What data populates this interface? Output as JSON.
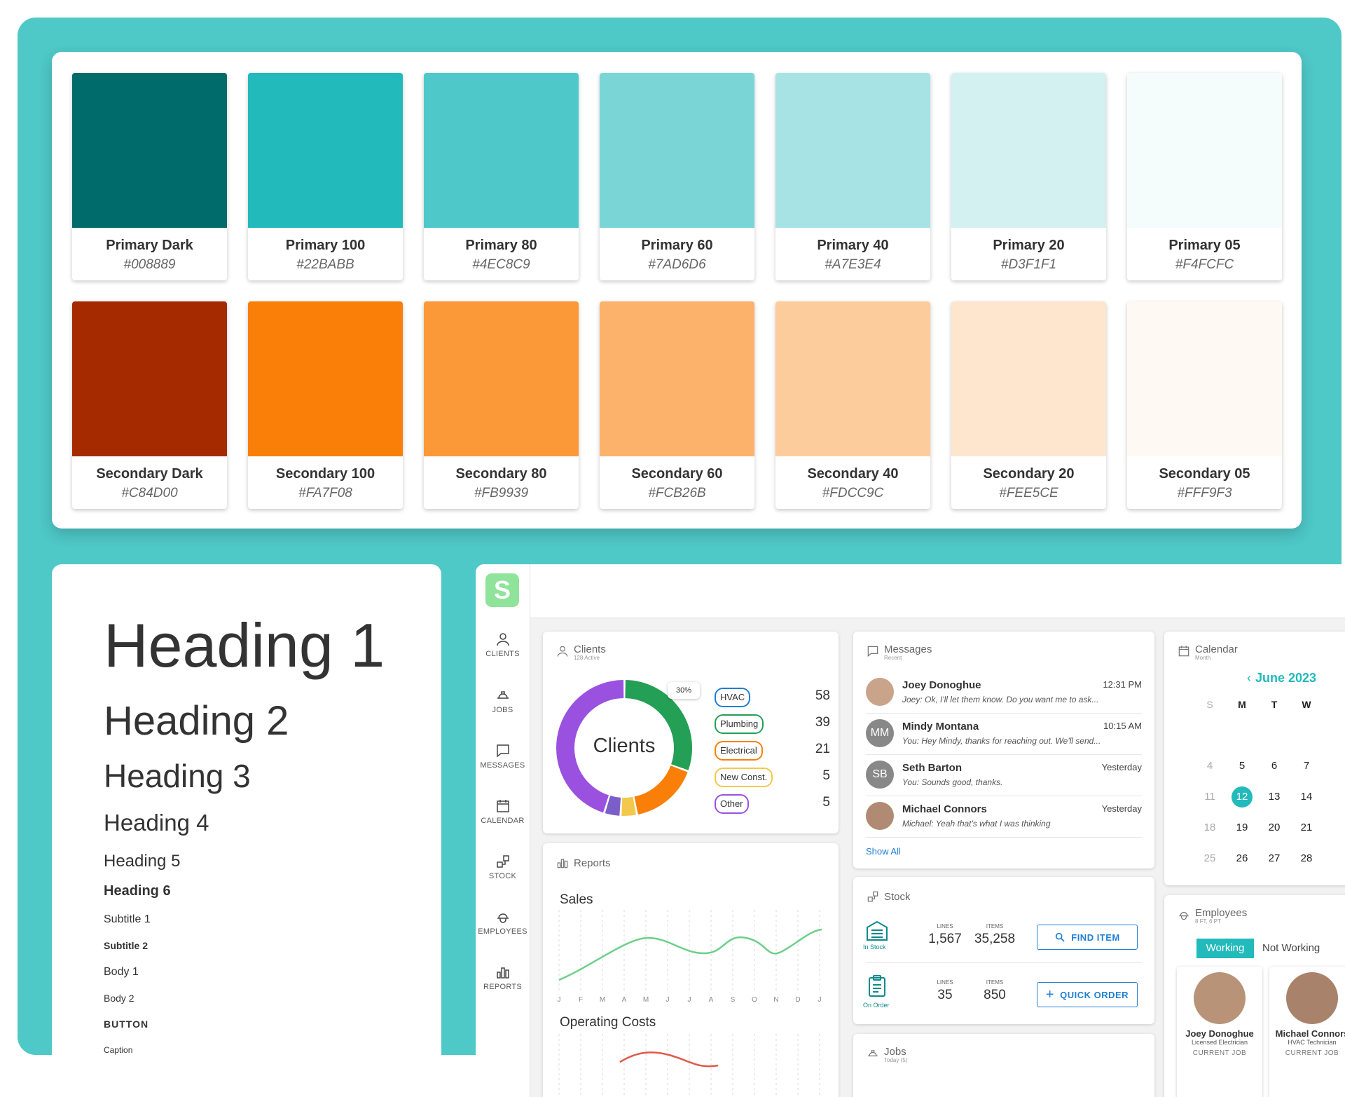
{
  "palette": {
    "primary": [
      {
        "name": "Primary Dark",
        "hex": "#008889",
        "color": "#006b6b"
      },
      {
        "name": "Primary 100",
        "hex": "#22BABB",
        "color": "#22babb"
      },
      {
        "name": "Primary 80",
        "hex": "#4EC8C9",
        "color": "#4ec8c9"
      },
      {
        "name": "Primary 60",
        "hex": "#7AD6D6",
        "color": "#7ad6d6"
      },
      {
        "name": "Primary 40",
        "hex": "#A7E3E4",
        "color": "#a7e3e4"
      },
      {
        "name": "Primary 20",
        "hex": "#D3F1F1",
        "color": "#d3f1f1"
      },
      {
        "name": "Primary 05",
        "hex": "#F4FCFC",
        "color": "#f4fcfc"
      }
    ],
    "secondary": [
      {
        "name": "Secondary Dark",
        "hex": "#C84D00",
        "color": "#a52a00"
      },
      {
        "name": "Secondary 100",
        "hex": "#FA7F08",
        "color": "#fa7f08"
      },
      {
        "name": "Secondary 80",
        "hex": "#FB9939",
        "color": "#fb9939"
      },
      {
        "name": "Secondary 60",
        "hex": "#FCB26B",
        "color": "#fcb26b"
      },
      {
        "name": "Secondary 40",
        "hex": "#FDCC9C",
        "color": "#fdcc9c"
      },
      {
        "name": "Secondary 20",
        "hex": "#FEE5CE",
        "color": "#fee5ce"
      },
      {
        "name": "Secondary 05",
        "hex": "#FFF9F3",
        "color": "#fff9f3"
      }
    ]
  },
  "typography": {
    "h1": "Heading 1",
    "h2": "Heading 2",
    "h3": "Heading 3",
    "h4": "Heading 4",
    "h5": "Heading 5",
    "h6": "Heading 6",
    "subtitle1": "Subtitle 1",
    "subtitle2": "Subtitle 2",
    "body1": "Body 1",
    "body2": "Body 2",
    "button": "BUTTON",
    "caption": "Caption"
  },
  "app": {
    "logo": "S",
    "nav": [
      "CLIENTS",
      "JOBS",
      "MESSAGES",
      "CALENDAR",
      "STOCK",
      "EMPLOYEES",
      "REPORTS"
    ],
    "clients": {
      "title": "Clients",
      "subtitle": "128 Active",
      "center": "Clients",
      "callout": "30%",
      "legend": [
        {
          "label": "HVAC",
          "count": "58",
          "color": "#1f7fd4"
        },
        {
          "label": "Plumbing",
          "count": "39",
          "color": "#23a055"
        },
        {
          "label": "Electrical",
          "count": "21",
          "color": "#fa7f08"
        },
        {
          "label": "New Const.",
          "count": "5",
          "color": "#f2c94c"
        },
        {
          "label": "Other",
          "count": "5",
          "color": "#9b51e0"
        }
      ]
    },
    "chart_data": {
      "type": "pie",
      "categories": [
        "HVAC",
        "Plumbing",
        "Electrical",
        "New Const.",
        "Other"
      ],
      "values": [
        58,
        39,
        21,
        5,
        5
      ],
      "colors": [
        "#9b51e0",
        "#23a055",
        "#fa7f08",
        "#f2c94c",
        "#7b5fc9"
      ]
    },
    "reports": {
      "title": "Reports",
      "sales": "Sales",
      "costs": "Operating Costs",
      "months": [
        "J",
        "F",
        "M",
        "A",
        "M",
        "J",
        "J",
        "A",
        "S",
        "O",
        "N",
        "D",
        "J"
      ]
    },
    "messages": {
      "title": "Messages",
      "subtitle": "Recent",
      "show_all": "Show All",
      "items": [
        {
          "name": "Joey Donoghue",
          "time": "12:31 PM",
          "preview": "Joey: Ok, I'll let them know. Do you want me to ask...",
          "initials": ""
        },
        {
          "name": "Mindy Montana",
          "time": "10:15 AM",
          "preview": "You: Hey Mindy, thanks for reaching out. We'll send...",
          "initials": "MM"
        },
        {
          "name": "Seth Barton",
          "time": "Yesterday",
          "preview": "You: Sounds good, thanks.",
          "initials": "SB"
        },
        {
          "name": "Michael Connors",
          "time": "Yesterday",
          "preview": "Michael: Yeah that's what I was thinking",
          "initials": ""
        }
      ]
    },
    "stock": {
      "title": "Stock",
      "rows": [
        {
          "status": "In Stock",
          "lines_label": "LINES",
          "lines": "1,567",
          "items_label": "ITEMS",
          "items": "35,258",
          "button": "FIND ITEM"
        },
        {
          "status": "On Order",
          "lines_label": "LINES",
          "lines": "35",
          "items_label": "ITEMS",
          "items": "850",
          "button": "QUICK ORDER"
        }
      ]
    },
    "jobs": {
      "title": "Jobs",
      "subtitle": "Today (5)"
    },
    "calendar": {
      "title": "Calendar",
      "subtitle": "Month",
      "month": "June 2023",
      "weekdays": [
        "S",
        "M",
        "T",
        "W"
      ],
      "rows": [
        [
          "4",
          "5",
          "6",
          "7"
        ],
        [
          "11",
          "12",
          "13",
          "14"
        ],
        [
          "18",
          "19",
          "20",
          "21"
        ],
        [
          "25",
          "26",
          "27",
          "28"
        ]
      ],
      "selected": "12"
    },
    "employees": {
      "title": "Employees",
      "subtitle": "8 FT, 6 PT",
      "tab_active": "Working",
      "tab_inactive": "Not Working",
      "people": [
        {
          "name": "Joey Donoghue",
          "role": "Licensed Electrician",
          "label": "CURRENT JOB"
        },
        {
          "name": "Michael Connors",
          "role": "HVAC Technician",
          "label": "CURRENT JOB"
        }
      ]
    }
  }
}
